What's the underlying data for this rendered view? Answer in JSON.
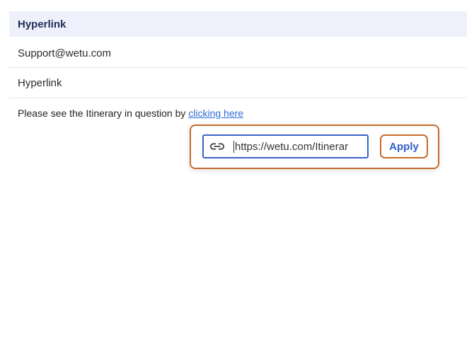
{
  "header": {
    "title": "Hyperlink"
  },
  "fields": {
    "email": "Support@wetu.com",
    "link_text": "Hyperlink"
  },
  "body": {
    "text_before_link": "Please see the Itinerary in question by ",
    "link_text": "clicking here"
  },
  "link_popover": {
    "icon": "link-icon",
    "url_value": "https://wetu.com/Itinerar",
    "apply_label": "Apply"
  },
  "colors": {
    "header_bg": "#eef1fb",
    "header_text": "#1f2c57",
    "link": "#2f6ad6",
    "highlight_outline": "#c96a2c",
    "input_border": "#3a63c4"
  }
}
